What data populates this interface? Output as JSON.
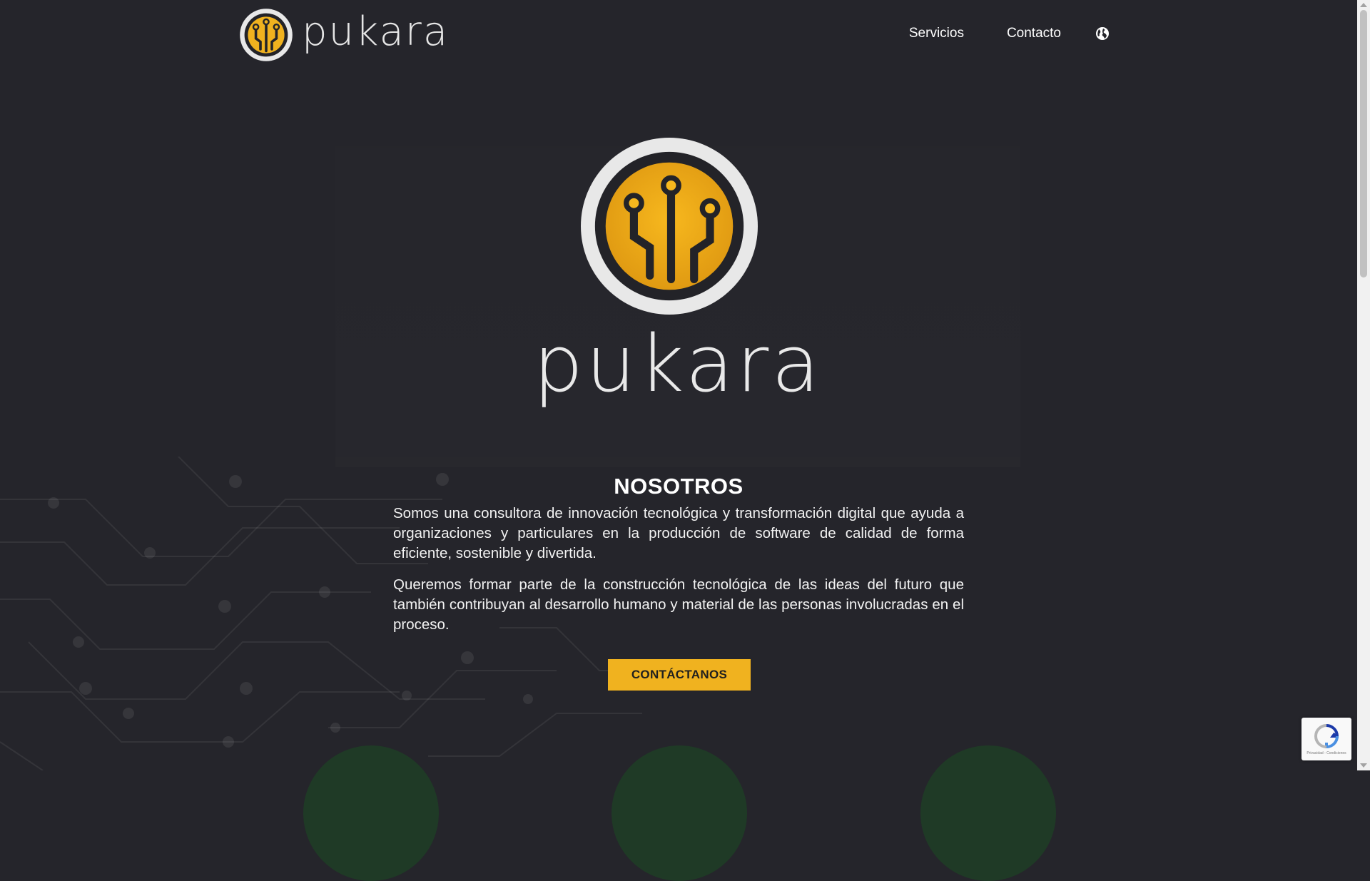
{
  "brand": {
    "name": "pukara",
    "colors": {
      "accent": "#f0b21f",
      "ring": "#e8e8e8",
      "background": "#25252b",
      "dark": "#232328"
    }
  },
  "nav": {
    "links": [
      {
        "label": "Servicios"
      },
      {
        "label": "Contacto"
      }
    ],
    "language_icon": "globe-icon"
  },
  "hero": {
    "wordmark": "pukara"
  },
  "about": {
    "title": "NOSOTROS",
    "paragraphs": [
      "Somos una consultora de innovación tecnológica y transformación digital que ayuda a organizaciones y particulares en la producción de software de calidad de forma eficiente, sostenible y divertida.",
      "Queremos formar parte de la construcción tecnológica de las ideas del futuro que también contribuyan al desarrollo humano y material de las personas involucradas en el proceso."
    ],
    "cta_label": "CONTÁCTANOS"
  },
  "recaptcha": {
    "text": "Privacidad - Condiciones"
  }
}
